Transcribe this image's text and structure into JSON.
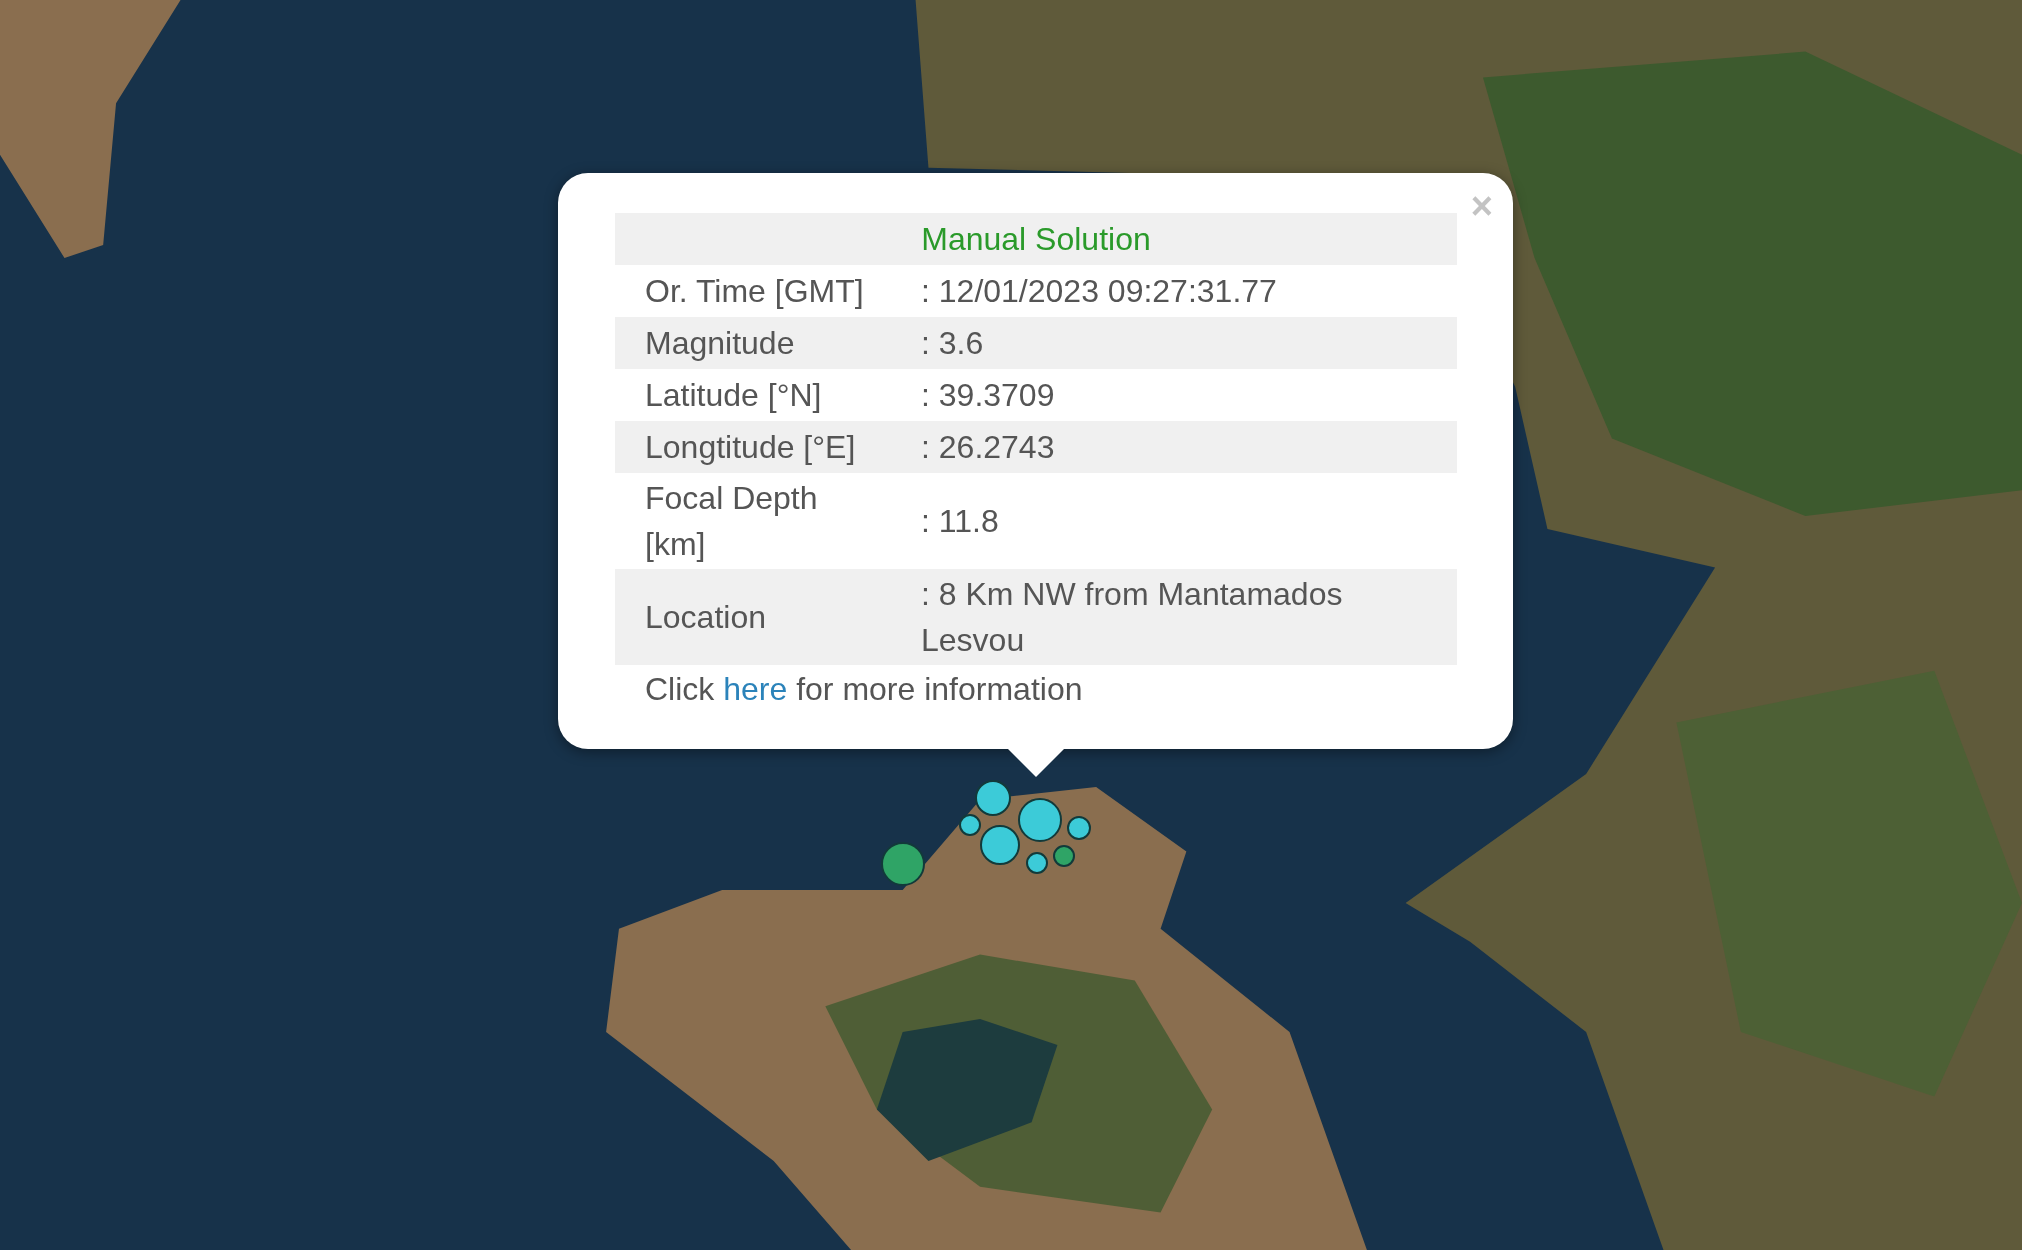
{
  "popup": {
    "close": "×",
    "title": "Manual Solution",
    "rows": [
      {
        "label": "Or. Time [GMT]",
        "value": ": 12/01/2023 09:27:31.77"
      },
      {
        "label": "Magnitude",
        "value": ": 3.6"
      },
      {
        "label": "Latitude [°N]",
        "value": ": 39.3709"
      },
      {
        "label": "Longtitude [°E]",
        "value": ": 26.2743"
      },
      {
        "label": "Focal Depth [km]",
        "value": ": 11.8"
      },
      {
        "label": "Location",
        "value": ": 8 Km NW from Mantamados Lesvou"
      }
    ],
    "footer": {
      "before": "Click",
      "link": "here",
      "after": "for more information"
    }
  },
  "markers": [
    {
      "color": "#2fa466"
    },
    {
      "color": "#3ccbd8"
    },
    {
      "color": "#3ccbd8"
    },
    {
      "color": "#3ccbd8"
    },
    {
      "color": "#3ccbd8"
    },
    {
      "color": "#2fa466"
    },
    {
      "color": "#3ccbd8"
    },
    {
      "color": "#3ccbd8"
    }
  ]
}
